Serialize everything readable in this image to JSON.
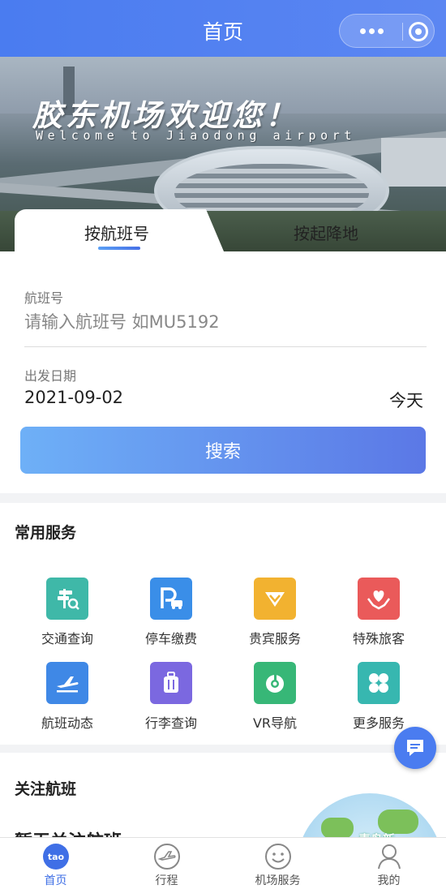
{
  "navbar": {
    "title": "首页"
  },
  "banner": {
    "title": "胶东机场欢迎您！",
    "subtitle": "Welcome to Jiaodong airport"
  },
  "search": {
    "tabs": [
      {
        "label": "按航班号",
        "active": true
      },
      {
        "label": "按起降地",
        "active": false
      }
    ],
    "flight_label": "航班号",
    "flight_placeholder": "请输入航班号 如MU5192",
    "date_label": "出发日期",
    "date_value": "2021-09-02",
    "date_hint": "今天",
    "button_label": "搜索"
  },
  "services": {
    "title": "常用服务",
    "items": [
      {
        "label": "交通查询",
        "icon": "traffic-sign-icon",
        "color": "#3fb8a8"
      },
      {
        "label": "停车缴费",
        "icon": "parking-icon",
        "color": "#3a8ee8"
      },
      {
        "label": "贵宾服务",
        "icon": "vip-diamond-icon",
        "color": "#f2b230"
      },
      {
        "label": "特殊旅客",
        "icon": "heart-hands-icon",
        "color": "#ea5a5a"
      },
      {
        "label": "航班动态",
        "icon": "airplane-icon",
        "color": "#3f88e6"
      },
      {
        "label": "行李查询",
        "icon": "luggage-icon",
        "color": "#7b68e0"
      },
      {
        "label": "VR导航",
        "icon": "vr-compass-icon",
        "color": "#37b777"
      },
      {
        "label": "更多服务",
        "icon": "clover-grid-icon",
        "color": "#37b7b0"
      }
    ]
  },
  "follow": {
    "title": "关注航班",
    "subtitle": "暂无关注航班",
    "watermark": "青岛新"
  },
  "tabbar": {
    "items": [
      {
        "label": "首页",
        "icon": "home-logo-icon",
        "active": true
      },
      {
        "label": "行程",
        "icon": "trip-plane-icon",
        "active": false
      },
      {
        "label": "机场服务",
        "icon": "smiley-icon",
        "active": false
      },
      {
        "label": "我的",
        "icon": "user-icon",
        "active": false
      }
    ]
  }
}
